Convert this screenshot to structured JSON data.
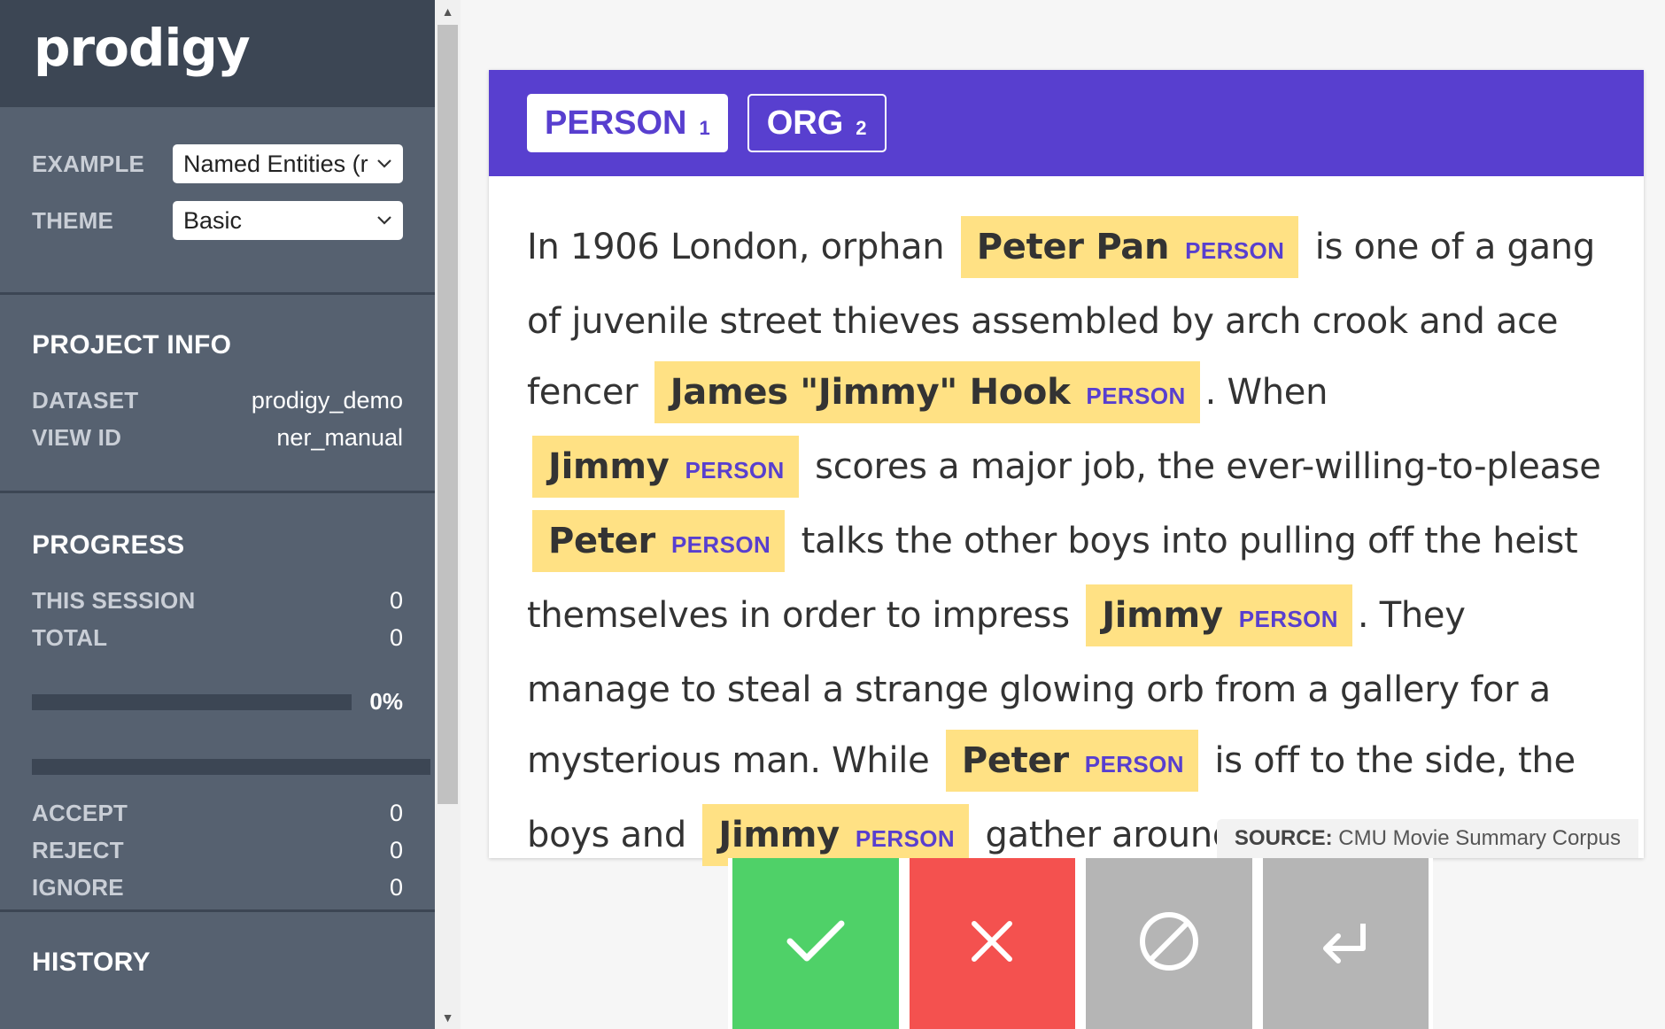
{
  "app": {
    "logo": "prodigy"
  },
  "settings": {
    "example_label": "EXAMPLE",
    "example_value": "Named Entities (r",
    "theme_label": "THEME",
    "theme_value": "Basic"
  },
  "project_info": {
    "heading": "PROJECT INFO",
    "dataset_label": "DATASET",
    "dataset_value": "prodigy_demo",
    "view_id_label": "VIEW ID",
    "view_id_value": "ner_manual"
  },
  "progress": {
    "heading": "PROGRESS",
    "this_session_label": "THIS SESSION",
    "this_session_value": "0",
    "total_label": "TOTAL",
    "total_value": "0",
    "percent_text": "0%",
    "percent_value": 0,
    "accept_label": "ACCEPT",
    "accept_value": "0",
    "reject_label": "REJECT",
    "reject_value": "0",
    "ignore_label": "IGNORE",
    "ignore_value": "0"
  },
  "history": {
    "heading": "HISTORY"
  },
  "labels": [
    {
      "name": "PERSON",
      "key": "1",
      "active": true
    },
    {
      "name": "ORG",
      "key": "2",
      "active": false
    }
  ],
  "text": {
    "t0": "In 1906 London, orphan",
    "e0": "Peter Pan",
    "t1": "is one of a gang of juvenile street thieves assembled by arch crook and ace fencer",
    "e1": "James \"Jimmy\" Hook",
    "t2": ". When",
    "e2": "Jimmy",
    "t3": "scores a major job, the ever-willing-to-please",
    "e3": "Peter",
    "t4": "talks the other boys into pulling off the heist themselves in order to impress",
    "e4": "Jimmy",
    "t5": ". They manage to steal a strange glowing orb from a gallery for a mysterious man. While",
    "e5": "Peter",
    "t6": "is off to the side, the boys and",
    "e6": "Jimmy",
    "t7": "gather around the orb.",
    "entity_label": "PERSON"
  },
  "source": {
    "label": "SOURCE:",
    "value": "CMU Movie Summary Corpus"
  },
  "actions": {
    "accept": "check-icon",
    "reject": "cross-icon",
    "ignore": "ban-icon",
    "undo": "return-icon",
    "colors": {
      "accept": "#4fd168",
      "reject": "#f4514f",
      "ignore": "#b5b5b5",
      "undo": "#b5b5b5"
    }
  },
  "colors": {
    "accent": "#583fcf",
    "highlight": "#ffe184",
    "sidebar": "#566170",
    "sidebar_dark": "#3c4654"
  }
}
